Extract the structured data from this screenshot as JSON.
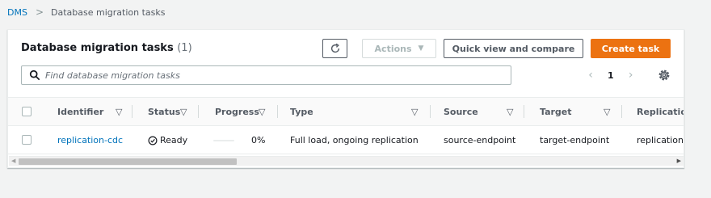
{
  "breadcrumb": {
    "root": "DMS",
    "separator": ">",
    "current": "Database migration tasks"
  },
  "panel": {
    "title": "Database migration tasks",
    "count": "(1)"
  },
  "toolbar": {
    "actions_label": "Actions",
    "compare_label": "Quick view and compare",
    "create_label": "Create task"
  },
  "search": {
    "placeholder": "Find database migration tasks"
  },
  "pagination": {
    "page": "1"
  },
  "table": {
    "columns": {
      "identifier": "Identifier",
      "status": "Status",
      "progress": "Progress",
      "type": "Type",
      "source": "Source",
      "target": "Target",
      "replication": "Replication"
    },
    "rows": [
      {
        "identifier": "replication-cdc",
        "status": "Ready",
        "progress": "0%",
        "progress_value": 0,
        "type": "Full load, ongoing replication",
        "source": "source-endpoint",
        "target": "target-endpoint",
        "replication": "replication-"
      }
    ]
  },
  "colors": {
    "accent": "#ec7211",
    "link": "#0073bb",
    "background": "#f2f3f3"
  },
  "icons": {
    "refresh": "refresh-icon",
    "search": "search-icon",
    "settings": "gear-icon",
    "status_ready": "check-circle-icon",
    "sort": "caret-down-icon"
  }
}
